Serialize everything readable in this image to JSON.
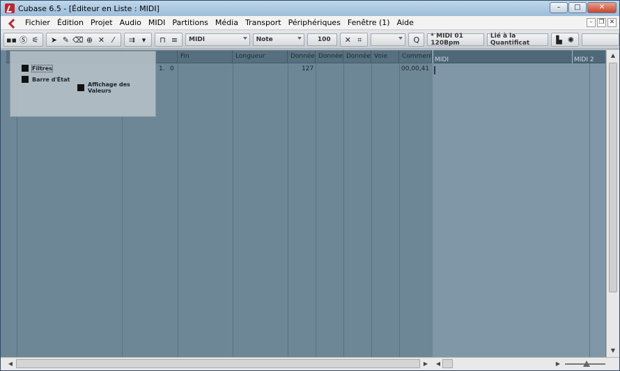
{
  "window": {
    "title": "Cubase 6.5 - [Éditeur en Liste : MIDI]",
    "minimize": "–",
    "maximize": "□",
    "close": "✕"
  },
  "menubar": {
    "items": [
      "Fichier",
      "Édition",
      "Projet",
      "Audio",
      "MIDI",
      "Partitions",
      "Média",
      "Transport",
      "Périphériques",
      "Fenêtre (1)",
      "Aide"
    ],
    "mdi_min": "–",
    "mdi_restore": "❐",
    "mdi_close": "✕"
  },
  "toolbar": {
    "track_selector": "MIDI",
    "event_type": "Note",
    "velocity": "100",
    "track_info": "* MIDI 01  120Bpm",
    "quantize_link": "Lié à la Quantificat"
  },
  "columns": {
    "headers": [
      "",
      "",
      "Fin",
      "Longueur",
      "Donnée",
      "Donnée",
      "Donnée",
      "Voie",
      "Commentai"
    ]
  },
  "row": {
    "start_bar": "1.",
    "start_tick": "0",
    "velocity": "127",
    "comment": "00,00,41"
  },
  "ruler": {
    "marks": [
      "MIDI",
      "MIDI 2"
    ]
  },
  "popup": {
    "filters": "Filtres",
    "status_bar": "Barre d'État",
    "value_display": "Affichage des Valeurs"
  }
}
